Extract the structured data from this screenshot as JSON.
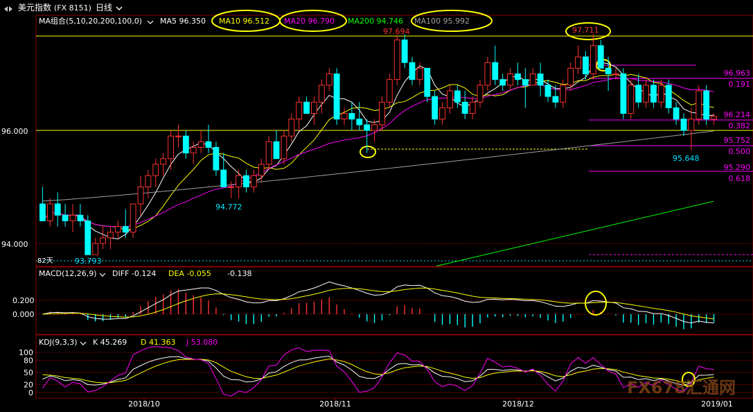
{
  "toolbar": {
    "title": "美元指数",
    "code": "(FX 8151)",
    "period": "日线"
  },
  "colors": {
    "up": "#ff3232",
    "down": "#00ffff",
    "ma5": "#ffffff",
    "ma10": "#ffff00",
    "ma20": "#ff00ff",
    "ma200": "#00ff00",
    "ma100": "#a0a0a0",
    "grid": "#8b0000",
    "fib": "#ff00ff",
    "annotation": "#ffff00",
    "price_label_red": "#ff3232",
    "price_label_cyan": "#00e5ff"
  },
  "chart_data": {
    "type": "candlestick",
    "instrument": "美元指数",
    "x_labels": [
      "2018/10",
      "2018/11",
      "2018/12",
      "2019/01"
    ],
    "y_ticks": [
      94.0,
      96.0
    ],
    "ylim": [
      93.6,
      98.0
    ],
    "candles": [
      [
        94.7,
        95.0,
        94.4,
        94.4
      ],
      [
        94.4,
        94.8,
        94.3,
        94.7
      ],
      [
        94.7,
        94.9,
        94.3,
        94.5
      ],
      [
        94.5,
        94.7,
        94.3,
        94.4
      ],
      [
        94.4,
        94.7,
        94.2,
        94.5
      ],
      [
        94.5,
        94.7,
        94.3,
        94.4
      ],
      [
        94.4,
        94.5,
        93.8,
        93.8
      ],
      [
        93.8,
        94.1,
        93.8,
        94.0
      ],
      [
        94.0,
        94.3,
        93.9,
        94.1
      ],
      [
        94.1,
        94.3,
        93.9,
        94.2
      ],
      [
        94.2,
        94.4,
        94.1,
        94.3
      ],
      [
        94.3,
        94.6,
        94.1,
        94.2
      ],
      [
        94.2,
        94.7,
        94.1,
        94.7
      ],
      [
        94.7,
        95.2,
        94.5,
        95.0
      ],
      [
        95.0,
        95.3,
        94.8,
        95.2
      ],
      [
        95.2,
        95.5,
        95.0,
        95.4
      ],
      [
        95.4,
        95.6,
        95.2,
        95.5
      ],
      [
        95.5,
        96.0,
        95.3,
        95.9
      ],
      [
        95.9,
        96.1,
        95.7,
        95.9
      ],
      [
        95.9,
        96.0,
        95.5,
        95.6
      ],
      [
        95.6,
        95.8,
        95.4,
        95.7
      ],
      [
        95.7,
        96.0,
        95.6,
        95.8
      ],
      [
        95.8,
        96.1,
        95.6,
        95.7
      ],
      [
        95.7,
        95.8,
        95.2,
        95.3
      ],
      [
        95.3,
        95.6,
        95.0,
        95.0
      ],
      [
        95.0,
        95.1,
        94.8,
        95.0
      ],
      [
        95.0,
        95.3,
        94.8,
        95.2
      ],
      [
        95.2,
        95.3,
        94.9,
        95.0
      ],
      [
        95.0,
        95.3,
        94.9,
        95.2
      ],
      [
        95.2,
        95.5,
        95.1,
        95.4
      ],
      [
        95.4,
        95.9,
        95.3,
        95.8
      ],
      [
        95.8,
        96.0,
        95.5,
        95.5
      ],
      [
        95.5,
        96.0,
        95.4,
        95.9
      ],
      [
        95.9,
        96.3,
        95.8,
        96.2
      ],
      [
        96.2,
        96.6,
        96.0,
        96.5
      ],
      [
        96.5,
        96.6,
        96.3,
        96.3
      ],
      [
        96.3,
        96.6,
        96.1,
        96.5
      ],
      [
        96.5,
        96.9,
        96.3,
        96.8
      ],
      [
        96.8,
        97.1,
        96.7,
        97.0
      ],
      [
        97.0,
        97.1,
        96.1,
        96.2
      ],
      [
        96.2,
        96.4,
        96.1,
        96.3
      ],
      [
        96.3,
        96.5,
        96.0,
        96.2
      ],
      [
        96.2,
        96.5,
        96.0,
        96.1
      ],
      [
        96.1,
        96.2,
        95.6,
        96.0
      ],
      [
        96.0,
        96.2,
        95.8,
        96.1
      ],
      [
        96.1,
        96.6,
        96.0,
        96.5
      ],
      [
        96.5,
        97.0,
        96.4,
        96.9
      ],
      [
        96.9,
        97.69,
        96.8,
        97.6
      ],
      [
        97.6,
        97.7,
        97.1,
        97.2
      ],
      [
        97.2,
        97.3,
        96.8,
        96.9
      ],
      [
        96.9,
        97.2,
        96.8,
        97.1
      ],
      [
        97.1,
        97.1,
        96.5,
        96.6
      ],
      [
        96.6,
        96.7,
        96.1,
        96.2
      ],
      [
        96.2,
        96.5,
        96.1,
        96.4
      ],
      [
        96.4,
        96.8,
        96.3,
        96.7
      ],
      [
        96.7,
        96.8,
        96.4,
        96.5
      ],
      [
        96.5,
        96.7,
        96.2,
        96.3
      ],
      [
        96.3,
        96.6,
        96.2,
        96.5
      ],
      [
        96.5,
        96.9,
        96.4,
        96.8
      ],
      [
        96.8,
        97.3,
        96.7,
        97.2
      ],
      [
        97.2,
        97.5,
        96.8,
        96.9
      ],
      [
        96.9,
        97.0,
        96.7,
        96.8
      ],
      [
        96.8,
        97.1,
        96.7,
        97.0
      ],
      [
        97.0,
        97.2,
        96.8,
        96.9
      ],
      [
        96.9,
        97.1,
        96.4,
        96.8
      ],
      [
        96.8,
        97.1,
        96.8,
        97.0
      ],
      [
        97.0,
        97.2,
        96.6,
        96.8
      ],
      [
        96.8,
        96.9,
        96.5,
        96.6
      ],
      [
        96.6,
        96.8,
        96.4,
        96.5
      ],
      [
        96.5,
        96.9,
        96.4,
        96.8
      ],
      [
        96.8,
        97.2,
        96.7,
        97.1
      ],
      [
        97.1,
        97.5,
        97.0,
        97.3
      ],
      [
        97.3,
        97.4,
        96.9,
        97.0
      ],
      [
        97.0,
        97.711,
        96.9,
        97.5
      ],
      [
        97.5,
        97.6,
        97.1,
        97.1
      ],
      [
        97.1,
        97.3,
        96.7,
        97.0
      ],
      [
        97.0,
        97.1,
        96.9,
        97.0
      ],
      [
        97.0,
        97.1,
        96.2,
        96.3
      ],
      [
        96.3,
        96.9,
        96.2,
        96.8
      ],
      [
        96.8,
        97.0,
        96.4,
        96.5
      ],
      [
        96.5,
        96.9,
        96.4,
        96.8
      ],
      [
        96.8,
        96.9,
        96.4,
        96.5
      ],
      [
        96.5,
        96.9,
        96.4,
        96.8
      ],
      [
        96.8,
        96.9,
        96.3,
        96.4
      ],
      [
        96.4,
        96.5,
        96.1,
        96.2
      ],
      [
        96.2,
        96.3,
        95.9,
        96.0
      ],
      [
        96.0,
        96.4,
        95.648,
        96.2
      ],
      [
        96.2,
        96.8,
        96.1,
        96.7
      ],
      [
        96.7,
        96.8,
        96.1,
        96.2
      ],
      [
        96.2,
        96.3,
        96.1,
        96.25
      ]
    ],
    "moving_averages": [
      {
        "name": "MA5",
        "value": 96.35
      },
      {
        "name": "MA10",
        "value": 96.512
      },
      {
        "name": "MA20",
        "value": 96.79
      },
      {
        "name": "MA200",
        "value": 94.746
      },
      {
        "name": "MA100",
        "value": 95.992
      }
    ],
    "price_annotations": [
      {
        "text": "97.694",
        "value": 97.694
      },
      {
        "text": "97.711",
        "value": 97.711
      },
      {
        "text": "94.772",
        "value": 94.772
      },
      {
        "text": "93.793",
        "value": 93.793
      },
      {
        "text": "95.648",
        "value": 95.648
      }
    ],
    "fib_levels": [
      {
        "price": "96.963",
        "ratio": "0.191"
      },
      {
        "price": "96.214",
        "ratio": "0.382"
      },
      {
        "price": "95.752",
        "ratio": "0.500"
      },
      {
        "price": "95.290",
        "ratio": "0.618"
      }
    ],
    "macd": {
      "params": "MACD(12,26,9)",
      "diff_label": "DIFF",
      "diff": -0.124,
      "dea_label": "DEA",
      "dea": -0.055,
      "macd": -0.138,
      "y_ticks": [
        0.2,
        0.0
      ]
    },
    "kdj": {
      "params": "KDJ(9,3,3)",
      "k_label": "K",
      "k": 45.269,
      "d_label": "D",
      "d": 41.363,
      "j_label": "J",
      "j": 53.08,
      "y_ticks": [
        100,
        80,
        50,
        20,
        0
      ]
    }
  },
  "labels": {
    "ma_group": "MA组合(5,10,20,200,100,0)",
    "ma5": "MA5 96.350",
    "ma10": "MA10 96.512",
    "ma20": "MA20 96.790",
    "ma200": "MA200 94.746",
    "ma100": "MA100 95.992",
    "days_label": "82天",
    "tick_96": "96.000",
    "tick_94": "94.000",
    "macd_title": "MACD(12,26,9)",
    "diff_text": "DIFF -0.124",
    "dea_text": "DEA -0.055",
    "macd_val": "-0.138",
    "macd_tick_02": "0.200",
    "macd_tick_0": "0.000",
    "kdj_title": "KDJ(9,3,3)",
    "k_text": "K 45.269",
    "d_text": "D 41.363",
    "j_text": "J 53.080",
    "kdj_ticks": [
      "100",
      "80",
      "50",
      "20",
      "0"
    ],
    "watermark": "FX678汇通网"
  }
}
